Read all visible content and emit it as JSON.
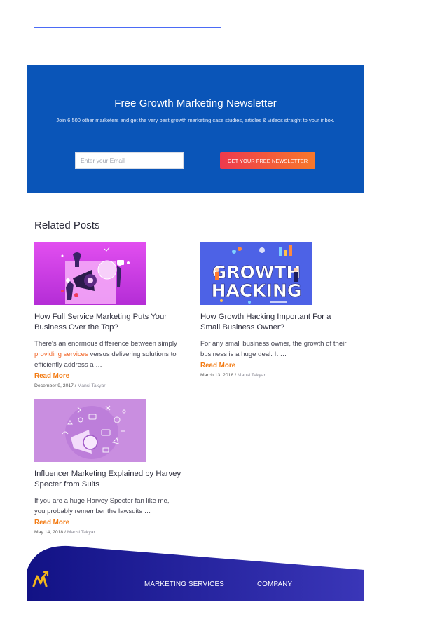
{
  "newsletter": {
    "title": "Free Growth Marketing Newsletter",
    "subtitle": "Join 6,500 other marketers and get the very best growth marketing case studies, articles & videos straight to your inbox.",
    "email_placeholder": "Enter your Email",
    "button_label": "GET YOUR FREE NEWSLETTER"
  },
  "related": {
    "heading": "Related Posts",
    "read_more_label": "Read More",
    "posts": [
      {
        "title": "How Full Service Marketing Puts Your Business Over the Top?",
        "excerpt_before": "There's an enormous difference between simply ",
        "excerpt_link": "providing services",
        "excerpt_after": " versus delivering solutions to efficiently address a …",
        "date": "December 9, 2017",
        "author": "Mansi Takyar",
        "image_text": ""
      },
      {
        "title": "How Growth Hacking Important For a Small Business Owner?",
        "excerpt_before": "For any small business owner, the growth of their business is a huge deal. It …",
        "excerpt_link": "",
        "excerpt_after": "",
        "date": "March 13, 2018",
        "author": "Mansi Takyar",
        "image_text_line1": "GROWTH",
        "image_text_line2": "HACKING"
      },
      {
        "title": "Influencer Marketing Explained by Harvey Specter from Suits",
        "excerpt_before": "If you are a huge Harvey Specter fan like me, you probably remember the lawsuits …",
        "excerpt_link": "",
        "excerpt_after": "",
        "date": "May 14, 2018",
        "author": "Mansi Takyar"
      }
    ]
  },
  "footer": {
    "nav": [
      "MARKETING SERVICES",
      "COMPANY"
    ],
    "logo_icon": "m-arrow-logo-icon"
  },
  "colors": {
    "newsletter_bg": "#0a55b8",
    "accent_orange": "#f27a12",
    "footer_bg": "#1e1f9c"
  }
}
